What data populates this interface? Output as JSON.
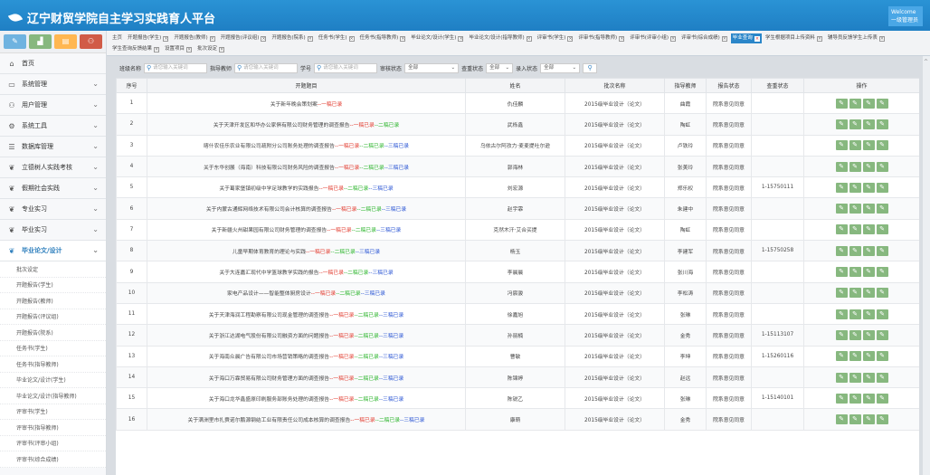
{
  "header": {
    "title": "辽宁财贸学院自主学习实践育人平台",
    "welcome": "Welcome",
    "user": "一级管理员"
  },
  "sidebar": {
    "shortcuts": [
      "pencil-icon",
      "chart-icon",
      "doc-icon",
      "users-icon"
    ],
    "items": [
      {
        "label": "首页",
        "icon": "home-icon",
        "chevron": false
      },
      {
        "label": "系统管理",
        "icon": "monitor-icon",
        "chevron": true
      },
      {
        "label": "用户管理",
        "icon": "users-icon",
        "chevron": true
      },
      {
        "label": "系统工具",
        "icon": "gear-icon",
        "chevron": true
      },
      {
        "label": "数据库管理",
        "icon": "database-icon",
        "chevron": true
      },
      {
        "label": "立德树人实践考核",
        "icon": "leaf-icon",
        "chevron": true
      },
      {
        "label": "假期社会实践",
        "icon": "leaf-icon",
        "chevron": true
      },
      {
        "label": "专业实习",
        "icon": "leaf-icon",
        "chevron": true
      },
      {
        "label": "毕业实习",
        "icon": "leaf-icon",
        "chevron": true
      },
      {
        "label": "毕业论文/设计",
        "icon": "leaf-icon",
        "chevron": true,
        "active": true
      }
    ],
    "subitems": [
      "批次设定",
      "开题报告(学生)",
      "开题报告(教师)",
      "开题报告(评议组)",
      "开题报告(院系)",
      "任务书(学生)",
      "任务书(指导教师)",
      "毕业论文/设计(学生)",
      "毕业论文/设计(指导教师)",
      "评审书(学生)",
      "评审书(指导教师)",
      "评审书(评审小组)",
      "评审书(综合成绩)"
    ]
  },
  "tabs": [
    {
      "label": "主页",
      "closable": false
    },
    {
      "label": "开题报告(学生)",
      "closable": true
    },
    {
      "label": "开题报告(教师)",
      "closable": true
    },
    {
      "label": "开题报告(评议组)",
      "closable": true
    },
    {
      "label": "开题报告(院系)",
      "closable": true
    },
    {
      "label": "任务书(学生)",
      "closable": true
    },
    {
      "label": "任务书(指导教师)",
      "closable": true
    },
    {
      "label": "毕业论文/设计(学生)",
      "closable": true
    },
    {
      "label": "毕业论文/设计(指导教师)",
      "closable": true
    },
    {
      "label": "评审书(学生)",
      "closable": true
    },
    {
      "label": "评审书(指导教师)",
      "closable": true
    },
    {
      "label": "评审书(评审小组)",
      "closable": true
    },
    {
      "label": "评审书(综合成绩)",
      "closable": true
    },
    {
      "label": "毕业查询",
      "closable": true,
      "active": true
    },
    {
      "label": "学生根据项目上传资料",
      "closable": true
    },
    {
      "label": "辅导员反馈学生上传表",
      "closable": true
    },
    {
      "label": "学生查询反馈结果",
      "closable": true
    },
    {
      "label": "设置项目",
      "closable": true
    },
    {
      "label": "批次设定",
      "closable": true
    }
  ],
  "filters": {
    "class_label": "班级名称",
    "class_placeholder": "请您输入关键词",
    "teacher_label": "指导教师",
    "teacher_placeholder": "请您输入关键词",
    "student_label": "学号",
    "student_placeholder": "请您输入关键词",
    "review_label": "审核状态",
    "review_value": "全部",
    "check_label": "查重状态",
    "check_value": "全部",
    "entry_label": "录入状态",
    "entry_value": "全部"
  },
  "table": {
    "columns": [
      "序号",
      "开题题目",
      "姓名",
      "批次名称",
      "指导教师",
      "报告状态",
      "查重状态",
      "操作"
    ],
    "draft1": "一稿已录",
    "draft2": "二稿已录",
    "draft3": "三稿已录",
    "rows": [
      {
        "no": "1",
        "title": "关于新年晚会策划案",
        "drafts": 1,
        "name": "仇佳麟",
        "batch": "2015级毕业设计（论文）",
        "teacher": "曲霞",
        "status": "院系意见同意",
        "check": ""
      },
      {
        "no": "2",
        "title": "关于天津开发区和华办公家俱有限公司财务管理的调查报告",
        "drafts": 2,
        "name": "武栎鑫",
        "batch": "2015级毕业设计（论文）",
        "teacher": "陶虹",
        "status": "院系意见同意",
        "check": ""
      },
      {
        "no": "3",
        "title": "喀什农佳乐农业有限公司疏附分公司账务处理的调查报告",
        "drafts": 3,
        "name": "乌依古尔阿孜力·麦麦提吐尔逊",
        "batch": "2015级毕业设计（论文）",
        "teacher": "卢铁玲",
        "status": "院系意见同意",
        "check": ""
      },
      {
        "no": "4",
        "title": "关于东华创展（海南）科技有限公司财务风险的调查报告",
        "drafts": 3,
        "name": "郭海林",
        "batch": "2015级毕业设计（论文）",
        "teacher": "张美玲",
        "status": "院系意见同意",
        "check": ""
      },
      {
        "no": "5",
        "title": "关于葛家堡镇初级中学足球教学的实践报告",
        "drafts": 3,
        "name": "刘宏源",
        "batch": "2015级毕业设计（论文）",
        "teacher": "郑乐权",
        "status": "院系意见同意",
        "check": "1-15750111"
      },
      {
        "no": "6",
        "title": "关于内蒙古通辉网络技术有限公司会计核算的调查报告",
        "drafts": 3,
        "name": "赵宇霏",
        "batch": "2015级毕业设计（论文）",
        "teacher": "朱建中",
        "status": "院系意见同意",
        "check": ""
      },
      {
        "no": "7",
        "title": "关于新疆火州甜果园有限公司财务管理的调查报告",
        "drafts": 3,
        "name": "克然木汗·艾合买提",
        "batch": "2015级毕业设计（论文）",
        "teacher": "陶虹",
        "status": "院系意见同意",
        "check": ""
      },
      {
        "no": "8",
        "title": "儿童早期体育教育的理论与实践",
        "drafts": 3,
        "name": "杨玉",
        "batch": "2015级毕业设计（论文）",
        "teacher": "李建军",
        "status": "院系意见同意",
        "check": "1-15750258"
      },
      {
        "no": "9",
        "title": "关于大连嘉汇现代中学篮球教学实践的报告",
        "drafts": 3,
        "name": "李晨晨",
        "batch": "2015级毕业设计（论文）",
        "teacher": "张川海",
        "status": "院系意见同意",
        "check": ""
      },
      {
        "no": "10",
        "title": "家电产品设计——智能整体厨房设计",
        "drafts": 3,
        "name": "冯宸骏",
        "batch": "2015级毕业设计（论文）",
        "teacher": "李松涛",
        "status": "院系意见同意",
        "check": ""
      },
      {
        "no": "11",
        "title": "关于天津海润工程勘察有限公司现金管理的调查报告",
        "drafts": 3,
        "name": "徐嘉旭",
        "batch": "2015级毕业设计（论文）",
        "teacher": "张琳",
        "status": "院系意见同意",
        "check": ""
      },
      {
        "no": "12",
        "title": "关于浙江达湖电气股份有限公司融资方面的问题报告",
        "drafts": 3,
        "name": "孙丽楠",
        "batch": "2015级毕业设计（论文）",
        "teacher": "金秀",
        "status": "院系意见同意",
        "check": "1-15113107"
      },
      {
        "no": "13",
        "title": "关于海南众晨广告有限公司市场营销策略的调查报告",
        "drafts": 3,
        "name": "曹敏",
        "batch": "2015级毕业设计（论文）",
        "teacher": "李坤",
        "status": "院系意见同意",
        "check": "1-15260116"
      },
      {
        "no": "14",
        "title": "关于海口万霖贸易有限公司财务管理方面的调查报告",
        "drafts": 3,
        "name": "陈锦婷",
        "batch": "2015级毕业设计（论文）",
        "teacher": "赵远",
        "status": "院系意见同意",
        "check": ""
      },
      {
        "no": "15",
        "title": "关于海口龙华鑫盛原印刷服务部账务处理的调查报告",
        "drafts": 3,
        "name": "陈锐乙",
        "batch": "2015级毕业设计（论文）",
        "teacher": "张琳",
        "status": "院系意见同意",
        "check": "1-15140101"
      },
      {
        "no": "16",
        "title": "关于满洲里市扎赉诺尔鹏源钢结工业有限责任公司成本核算的调查报告",
        "drafts": 3,
        "name": "康萌",
        "batch": "2015级毕业设计（论文）",
        "teacher": "金秀",
        "status": "院系意见同意",
        "check": ""
      }
    ]
  }
}
